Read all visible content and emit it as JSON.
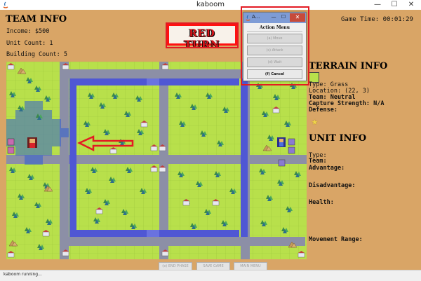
{
  "window": {
    "title": "kaboom",
    "min": "—",
    "max": "☐",
    "close": "✕"
  },
  "team_info": {
    "title": "TEAM INFO",
    "income": "Income: $500",
    "unit_count": "Unit Count: 1",
    "building_count": "Building Count: 5"
  },
  "game_time": "Game Time: 00:01:29",
  "turn_banner": "RED TURN",
  "terrain_info": {
    "title": "TERRAIN INFO",
    "type": "Type: Grass",
    "location": "Location: (22, 3)",
    "team": "Team: Neutral",
    "capture": "Capture Strength: N/A",
    "defense": "Defense:"
  },
  "unit_info": {
    "title": "UNIT INFO",
    "type": "Type:",
    "team": "Team:",
    "advantage": "Advantage:",
    "disadvantage": "Disadvantage:",
    "health": "Health:",
    "movement": "Movement Range:"
  },
  "bottom_buttons": {
    "end_phase": "(e) END PHASE",
    "save_game": "SAVE GAME",
    "main_menu": "MAIN MENU"
  },
  "status": "kaboom running...",
  "action_menu": {
    "title": "A...",
    "header": "Action Menu",
    "move": "(a) Move",
    "attack": "(s) Attack",
    "wait": "(d) Wait",
    "cancel": "(f) Cancel",
    "min": "—",
    "max": "☐",
    "close": "✕"
  },
  "colors": {
    "background": "#d9a566",
    "grass": "#b8e04b",
    "road": "#8c8fa6",
    "river": "#4f57d4",
    "highlight": "#e31b23",
    "turn_text": "#d9161b"
  }
}
